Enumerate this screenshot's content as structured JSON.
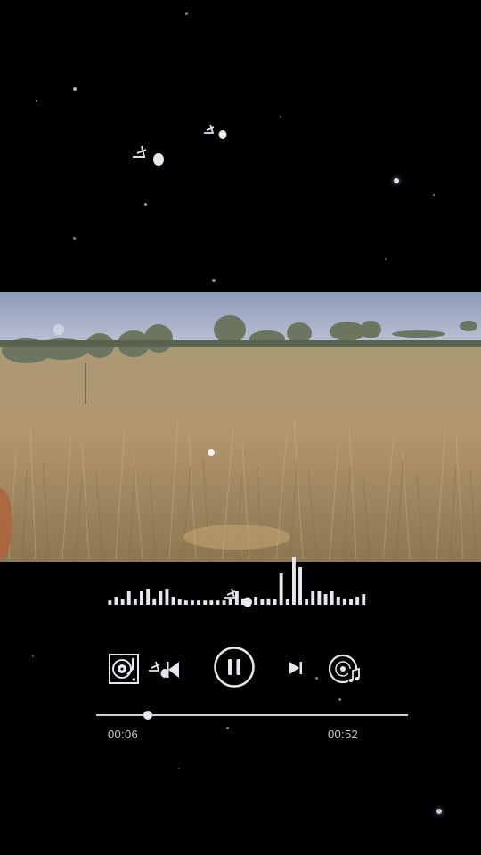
{
  "player": {
    "current_time": "00:06",
    "total_time": "00:52",
    "progress_fraction": 0.167,
    "state": "playing"
  },
  "equalizer": {
    "levels": [
      0.08,
      0.15,
      0.1,
      0.25,
      0.1,
      0.25,
      0.3,
      0.12,
      0.25,
      0.3,
      0.15,
      0.1,
      0.08,
      0.08,
      0.08,
      0.08,
      0.08,
      0.08,
      0.08,
      0.1,
      0.25,
      0.12,
      0.1,
      0.15,
      0.1,
      0.12,
      0.1,
      0.6,
      0.1,
      0.9,
      0.7,
      0.1,
      0.25,
      0.25,
      0.2,
      0.25,
      0.15,
      0.12,
      0.1,
      0.15,
      0.2
    ]
  },
  "icons": {
    "playlist": "vinyl-player-icon",
    "previous": "note-previous-icon",
    "play_pause": "pause-icon",
    "next": "next-icon",
    "music_disc": "music-disc-icon"
  },
  "colors": {
    "background": "#000000",
    "ui": "#e6e6ee",
    "sky": "#a3b0d0",
    "grass": "#b99a6c"
  }
}
